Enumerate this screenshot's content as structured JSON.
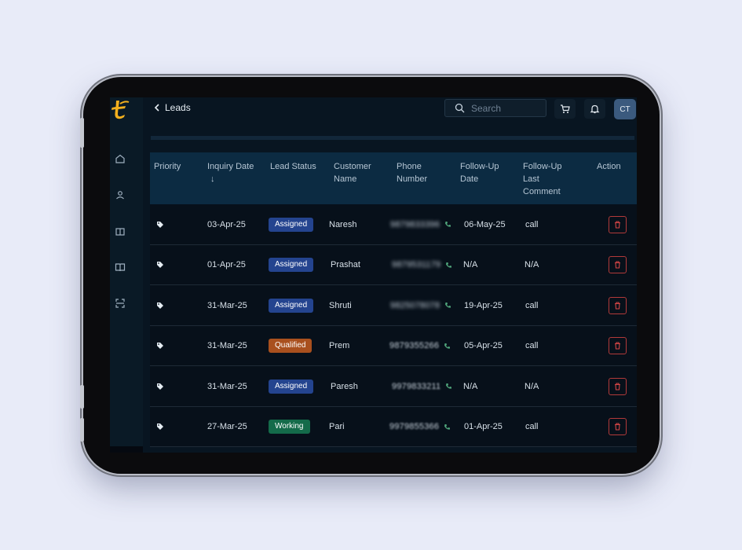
{
  "header": {
    "back_label": "Leads",
    "search_placeholder": "Search",
    "avatar_initials": "CT"
  },
  "sidebar": {
    "items": [
      {
        "icon": "home-icon"
      },
      {
        "icon": "user-icon"
      },
      {
        "icon": "book-open-icon"
      },
      {
        "icon": "book-icon"
      },
      {
        "icon": "scan-icon"
      }
    ]
  },
  "table": {
    "columns": [
      "Priority",
      "Inquiry Date",
      "Lead Status",
      "Customer Name",
      "Phone Number",
      "Follow-Up Date",
      "Follow-Up Last Comment",
      "Action"
    ],
    "sort_indicator": "↓",
    "rows": [
      {
        "inquiry_date": "03-Apr-25",
        "status": "Assigned",
        "customer": "Naresh",
        "phone": "9879833396",
        "followup_date": "06-May-25",
        "comment": "call"
      },
      {
        "inquiry_date": "01-Apr-25",
        "status": "Assigned",
        "customer": "Prashat",
        "phone": "9879531179",
        "followup_date": "N/A",
        "comment": "N/A"
      },
      {
        "inquiry_date": "31-Mar-25",
        "status": "Assigned",
        "customer": "Shruti",
        "phone": "9825078078",
        "followup_date": "19-Apr-25",
        "comment": "call"
      },
      {
        "inquiry_date": "31-Mar-25",
        "status": "Qualified",
        "customer": "Prem",
        "phone": "9879355266",
        "followup_date": "05-Apr-25",
        "comment": "call"
      },
      {
        "inquiry_date": "31-Mar-25",
        "status": "Assigned",
        "customer": "Paresh",
        "phone": "9979833211",
        "followup_date": "N/A",
        "comment": "N/A"
      },
      {
        "inquiry_date": "27-Mar-25",
        "status": "Working",
        "customer": "Pari",
        "phone": "9979855366",
        "followup_date": "01-Apr-25",
        "comment": "call"
      }
    ]
  },
  "colors": {
    "assigned": "#24448f",
    "qualified": "#a9501e",
    "working": "#146b4a",
    "accent_logo": "#f2b01e",
    "delete": "#b23a3a"
  }
}
